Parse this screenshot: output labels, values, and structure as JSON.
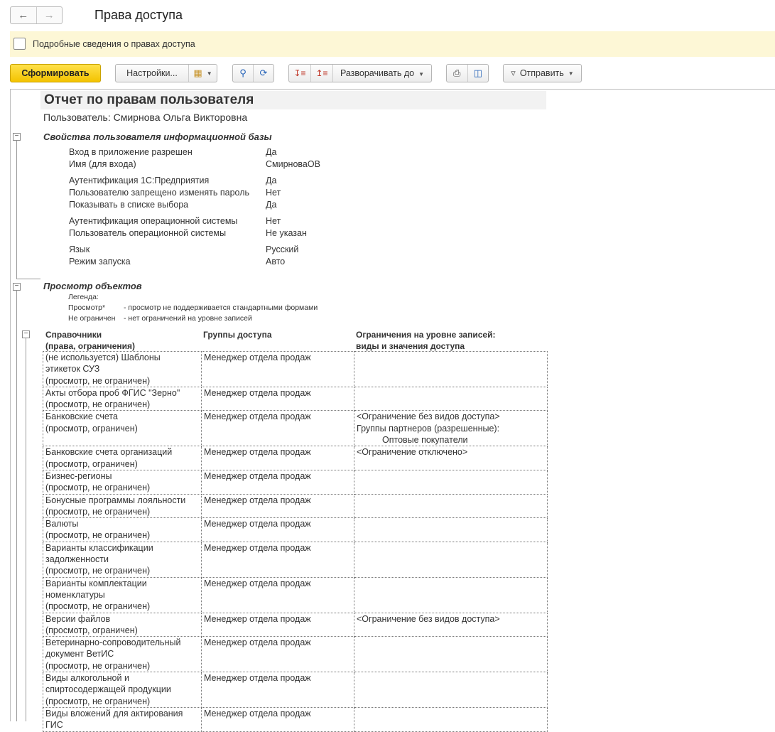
{
  "window": {
    "title": "Права доступа",
    "back_icon": "arrow-left-icon",
    "forward_icon": "arrow-right-icon"
  },
  "detail_checkbox": {
    "label": "Подробные сведения о правах доступа",
    "checked": false
  },
  "toolbar": {
    "generate_label": "Сформировать",
    "settings_label": "Настройки...",
    "expand_label": "Разворачивать до",
    "send_label": "Отправить"
  },
  "report": {
    "title": "Отчет по правам пользователя",
    "user_line": "Пользователь: Смирнова Ольга Викторовна",
    "section1": "Свойства пользователя информационной базы",
    "props": [
      {
        "k": "Вход в приложение разрешен",
        "v": "Да"
      },
      {
        "k": "Имя (для входа)",
        "v": "СмирноваОВ"
      },
      {
        "k": "Аутентификация 1С:Предприятия",
        "v": "Да"
      },
      {
        "k": "Пользователю запрещено изменять пароль",
        "v": "Нет"
      },
      {
        "k": "Показывать в списке выбора",
        "v": "Да"
      },
      {
        "k": "Аутентификация операционной системы",
        "v": "Нет"
      },
      {
        "k": "Пользователь операционной системы",
        "v": "Не указан"
      },
      {
        "k": "Язык",
        "v": "Русский"
      },
      {
        "k": "Режим запуска",
        "v": "Авто"
      }
    ],
    "section2": "Просмотр объектов",
    "legend_title": "Легенда:",
    "legend": [
      {
        "k": "Просмотр*",
        "v": "- просмотр не поддерживается стандартными формами"
      },
      {
        "k": "Не ограничен",
        "v": "- нет ограничений на уровне записей"
      }
    ],
    "headers": {
      "col1_line1": "Справочники",
      "col1_line2": "(права, ограничения)",
      "col2": "Группы доступа",
      "col3_line1": "Ограничения на уровне записей:",
      "col3_line2": "виды и значения доступа"
    },
    "rows": [
      {
        "c1": [
          "(не используется)  Шаблоны",
          "этикеток СУЗ",
          "(просмотр, не ограничен)"
        ],
        "c2": "Менеджер отдела продаж",
        "c3": []
      },
      {
        "c1": [
          "Акты отбора проб ФГИС \"Зерно\"",
          "(просмотр, не ограничен)"
        ],
        "c2": "Менеджер отдела продаж",
        "c3": []
      },
      {
        "c1": [
          "Банковские счета",
          "(просмотр, ограничен)"
        ],
        "c2": "Менеджер отдела продаж",
        "c3": [
          "<Ограничение без видов доступа>",
          "Группы партнеров (разрешенные):",
          "        Оптовые покупатели"
        ]
      },
      {
        "c1": [
          "Банковские счета организаций",
          "(просмотр, ограничен)"
        ],
        "c2": "Менеджер отдела продаж",
        "c3": [
          "<Ограничение отключено>"
        ]
      },
      {
        "c1": [
          "Бизнес-регионы",
          "(просмотр, не ограничен)"
        ],
        "c2": "Менеджер отдела продаж",
        "c3": []
      },
      {
        "c1": [
          "Бонусные программы лояльности",
          "(просмотр, не ограничен)"
        ],
        "c2": "Менеджер отдела продаж",
        "c3": []
      },
      {
        "c1": [
          "Валюты",
          "(просмотр, не ограничен)"
        ],
        "c2": "Менеджер отдела продаж",
        "c3": []
      },
      {
        "c1": [
          "Варианты классификации",
          "задолженности",
          "(просмотр, не ограничен)"
        ],
        "c2": "Менеджер отдела продаж",
        "c3": []
      },
      {
        "c1": [
          "Варианты комплектации",
          "номенклатуры",
          "(просмотр, не ограничен)"
        ],
        "c2": "Менеджер отдела продаж",
        "c3": []
      },
      {
        "c1": [
          "Версии файлов",
          "(просмотр, ограничен)"
        ],
        "c2": "Менеджер отдела продаж",
        "c3": [
          "<Ограничение без видов доступа>"
        ]
      },
      {
        "c1": [
          "Ветеринарно-сопроводительный",
          "документ ВетИС",
          "(просмотр, не ограничен)"
        ],
        "c2": "Менеджер отдела продаж",
        "c3": []
      },
      {
        "c1": [
          "Виды алкогольной и",
          "спиртосодержащей продукции",
          "(просмотр, не ограничен)"
        ],
        "c2": "Менеджер отдела продаж",
        "c3": []
      },
      {
        "c1": [
          "Виды вложений для актирования",
          "ГИС"
        ],
        "c2": "Менеджер отдела продаж",
        "c3": []
      }
    ]
  }
}
